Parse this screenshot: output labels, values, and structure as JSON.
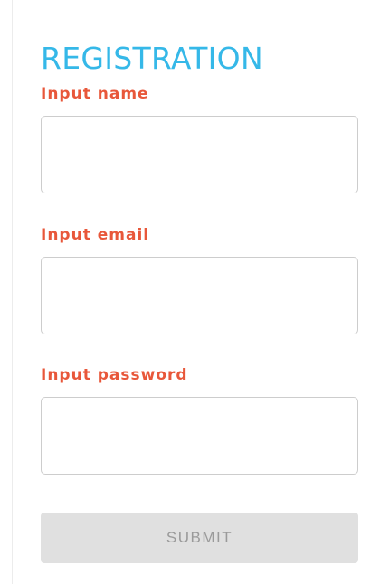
{
  "form": {
    "title": "REGISTRATION",
    "fields": [
      {
        "label": "Input name",
        "value": "",
        "placeholder": ""
      },
      {
        "label": "Input email",
        "value": "",
        "placeholder": ""
      },
      {
        "label": "Input password",
        "value": "",
        "placeholder": ""
      }
    ],
    "submit_label": "SUBMIT",
    "submit_disabled": true
  },
  "colors": {
    "title": "#35b8e8",
    "label": "#e8573a",
    "border": "#cdcdcd",
    "submit_bg": "#e0e0e0",
    "submit_text": "#9a9a9a"
  }
}
